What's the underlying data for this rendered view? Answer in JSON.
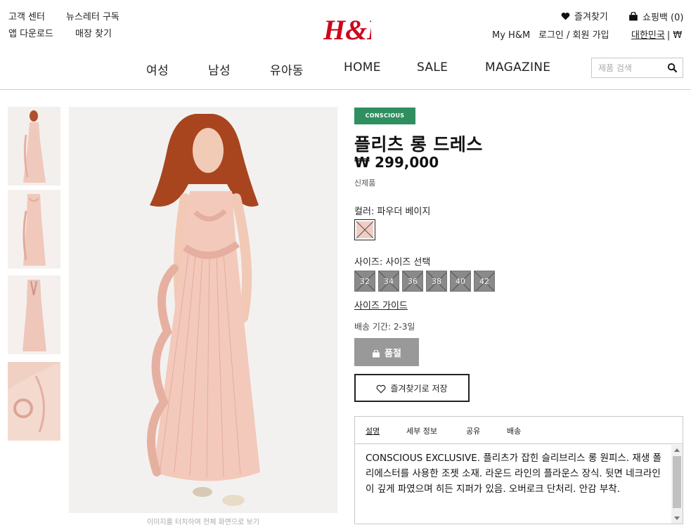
{
  "header": {
    "customer_center": "고객 센터",
    "newsletter": "뉴스레터 구독",
    "app_download": "앱 다운로드",
    "store_finder": "매장 찾기",
    "favorites": "즐겨찾기",
    "cart": "쇼핑백 (0)",
    "my_hm": "My H&M",
    "login": "로그인 / 회원 가입",
    "country": "대한민국",
    "currency": "| ₩",
    "logo_text": "H&M",
    "brand_color": "#cc071e"
  },
  "nav": {
    "items": [
      "여성",
      "남성",
      "유아동",
      "HOME",
      "SALE",
      "MAGAZINE"
    ],
    "search_placeholder": "제품 검색"
  },
  "gallery": {
    "caption": "이미지를 터치하여 전체 화면으로 보기"
  },
  "product": {
    "badge": "CONSCIOUS",
    "badge_color": "#2f8f5f",
    "title": "플리츠 롱 드레스",
    "price": "₩ 299,000",
    "new_tag": "신제품",
    "color_label": "컬러: 파우더 베이지",
    "swatch_color": "#f1cdc4",
    "size_label": "사이즈: 사이즈 선택",
    "sizes": [
      "32",
      "34",
      "36",
      "38",
      "40",
      "42"
    ],
    "size_guide": "사이즈 가이드",
    "delivery": "배송 기간: 2-3일",
    "sold_out": "품절",
    "save_favorite": "즐겨찾기로 저장"
  },
  "tabs": {
    "items": [
      "설명",
      "세부 정보",
      "공유",
      "배송"
    ],
    "active": "설명",
    "description": "CONSCIOUS EXCLUSIVE. 플리츠가 잡힌 슬리브리스 롱 원피스. 재생 폴리에스터를 사용한 조젯 소재. 라운드 라인의 플라운스 장식. 뒷면 네크라인이 깊게 파였으며 히든 지퍼가 있음. 오버로크 단처리. 안감 부착."
  }
}
